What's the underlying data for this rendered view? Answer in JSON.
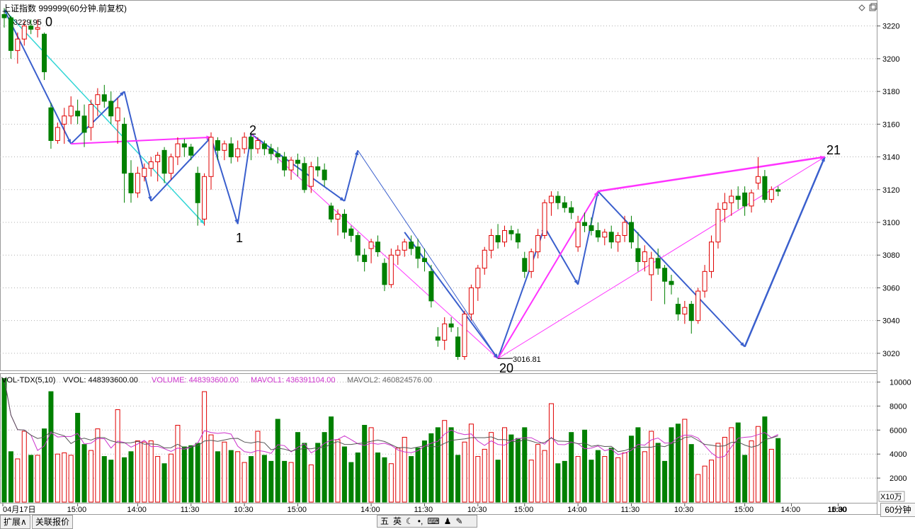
{
  "header": {
    "title": "上证指数 999999(60分钟.前复权)",
    "icons": [
      "diamond-icon",
      "restore-window-icon"
    ]
  },
  "price_axis": {
    "ticks": [
      "3220",
      "3200",
      "3180",
      "3160",
      "3140",
      "3120",
      "3100",
      "3080",
      "3060",
      "3040",
      "3020"
    ]
  },
  "volume_axis": {
    "ticks": [
      "10000",
      "8000",
      "6000",
      "4000",
      "2000"
    ],
    "unit": "X10万"
  },
  "volume_header": {
    "name": "VOL-TDX(5,10)",
    "vvol": "VVOL: 448393600.00",
    "volume": "VOLUME: 448393600.00",
    "mavol1": "MAVOL1: 436391104.00",
    "mavol2": "MAVOL2: 460824576.00"
  },
  "time_axis": [
    "04月17日",
    "15:00",
    "14:00",
    "11:30",
    "10:30",
    "15:00",
    "14:00",
    "11:30",
    "10:30",
    "15:00",
    "14:00",
    "11:30",
    "10:30",
    "15:00",
    "14:00",
    "11:30",
    "10:30",
    "15:00"
  ],
  "annotations": {
    "high_label": "3229.95",
    "low_label": "3016.81",
    "wave_labels": [
      "0",
      "1",
      "2",
      "20",
      "21"
    ]
  },
  "bottom_bar": {
    "tab_expand": "扩展∧",
    "tab_quote": "关联报价",
    "tray_items": [
      "五",
      "英",
      "☾",
      "•,",
      "⌨",
      "♟",
      "✎"
    ],
    "period": "60分钟"
  },
  "colors": {
    "up": "#e00000",
    "down": "#008000",
    "wave_blue": "#3a5fcd",
    "wave_magenta": "#ff33ff",
    "wave_cyan": "#33d6d6",
    "ma1": "#cc33cc",
    "ma2": "#555555",
    "grid": "#b0b0b0"
  },
  "chart_data": {
    "type": "candlestick",
    "price_range": [
      3010,
      3235
    ],
    "volume_range": [
      0,
      10500
    ],
    "candles": [
      [
        3227,
        3231,
        3219,
        3225
      ],
      [
        3225,
        3226,
        3200,
        3205
      ],
      [
        3205,
        3216,
        3197,
        3212
      ],
      [
        3212,
        3223,
        3208,
        3220
      ],
      [
        3220,
        3224,
        3215,
        3218
      ],
      [
        3218,
        3224,
        3213,
        3219
      ],
      [
        3215,
        3216,
        3187,
        3192
      ],
      [
        3170,
        3173,
        3145,
        3150
      ],
      [
        3150,
        3161,
        3148,
        3158
      ],
      [
        3160,
        3170,
        3148,
        3165
      ],
      [
        3165,
        3177,
        3160,
        3171
      ],
      [
        3168,
        3175,
        3160,
        3165
      ],
      [
        3165,
        3172,
        3146,
        3155
      ],
      [
        3158,
        3175,
        3150,
        3172
      ],
      [
        3172,
        3182,
        3165,
        3178
      ],
      [
        3178,
        3184,
        3170,
        3174
      ],
      [
        3174,
        3180,
        3160,
        3165
      ],
      [
        3162,
        3176,
        3148,
        3170
      ],
      [
        3160,
        3164,
        3112,
        3130
      ],
      [
        3130,
        3138,
        3112,
        3118
      ],
      [
        3118,
        3134,
        3115,
        3130
      ],
      [
        3128,
        3136,
        3125,
        3133
      ],
      [
        3133,
        3140,
        3128,
        3137
      ],
      [
        3137,
        3143,
        3125,
        3141
      ],
      [
        3144,
        3146,
        3124,
        3130
      ],
      [
        3130,
        3142,
        3126,
        3140
      ],
      [
        3140,
        3152,
        3135,
        3148
      ],
      [
        3148,
        3151,
        3140,
        3146
      ],
      [
        3146,
        3148,
        3138,
        3141
      ],
      [
        3130,
        3134,
        3098,
        3112
      ],
      [
        3102,
        3130,
        3098,
        3128
      ],
      [
        3128,
        3155,
        3120,
        3152
      ],
      [
        3150,
        3152,
        3138,
        3144
      ],
      [
        3144,
        3150,
        3138,
        3148
      ],
      [
        3148,
        3152,
        3136,
        3140
      ],
      [
        3140,
        3150,
        3137,
        3145
      ],
      [
        3145,
        3155,
        3142,
        3152
      ],
      [
        3152,
        3154,
        3138,
        3145
      ],
      [
        3145,
        3152,
        3142,
        3150
      ],
      [
        3148,
        3150,
        3141,
        3145
      ],
      [
        3145,
        3148,
        3138,
        3142
      ],
      [
        3142,
        3146,
        3136,
        3140
      ],
      [
        3140,
        3143,
        3128,
        3132
      ],
      [
        3132,
        3140,
        3126,
        3138
      ],
      [
        3138,
        3142,
        3128,
        3136
      ],
      [
        3136,
        3140,
        3118,
        3120
      ],
      [
        3122,
        3137,
        3118,
        3134
      ],
      [
        3134,
        3140,
        3128,
        3132
      ],
      [
        3132,
        3136,
        3122,
        3126
      ],
      [
        3110,
        3112,
        3100,
        3102
      ],
      [
        3102,
        3108,
        3092,
        3105
      ],
      [
        3105,
        3108,
        3090,
        3094
      ],
      [
        3096,
        3098,
        3088,
        3092
      ],
      [
        3092,
        3094,
        3076,
        3080
      ],
      [
        3080,
        3084,
        3070,
        3076
      ],
      [
        3084,
        3090,
        3075,
        3088
      ],
      [
        3088,
        3092,
        3079,
        3082
      ],
      [
        3075,
        3078,
        3058,
        3062
      ],
      [
        3062,
        3084,
        3060,
        3080
      ],
      [
        3080,
        3086,
        3074,
        3083
      ],
      [
        3083,
        3090,
        3079,
        3088
      ],
      [
        3088,
        3092,
        3080,
        3084
      ],
      [
        3085,
        3090,
        3072,
        3078
      ],
      [
        3078,
        3084,
        3070,
        3076
      ],
      [
        3070,
        3074,
        3048,
        3052
      ],
      [
        3030,
        3036,
        3024,
        3028
      ],
      [
        3028,
        3042,
        3022,
        3038
      ],
      [
        3038,
        3042,
        3033,
        3036
      ],
      [
        3030,
        3036,
        3016,
        3018
      ],
      [
        3018,
        3046,
        3016,
        3044
      ],
      [
        3044,
        3062,
        3040,
        3060
      ],
      [
        3060,
        3074,
        3052,
        3072
      ],
      [
        3072,
        3085,
        3068,
        3083
      ],
      [
        3083,
        3096,
        3078,
        3092
      ],
      [
        3092,
        3099,
        3084,
        3088
      ],
      [
        3088,
        3098,
        3085,
        3095
      ],
      [
        3095,
        3098,
        3089,
        3093
      ],
      [
        3093,
        3096,
        3084,
        3088
      ],
      [
        3078,
        3082,
        3066,
        3070
      ],
      [
        3070,
        3084,
        3066,
        3082
      ],
      [
        3082,
        3096,
        3078,
        3092
      ],
      [
        3092,
        3114,
        3090,
        3112
      ],
      [
        3112,
        3119,
        3104,
        3116
      ],
      [
        3116,
        3119,
        3108,
        3112
      ],
      [
        3112,
        3116,
        3106,
        3109
      ],
      [
        3109,
        3113,
        3102,
        3106
      ],
      [
        3085,
        3104,
        3082,
        3100
      ],
      [
        3100,
        3106,
        3094,
        3098
      ],
      [
        3098,
        3103,
        3092,
        3095
      ],
      [
        3095,
        3100,
        3088,
        3091
      ],
      [
        3091,
        3096,
        3086,
        3094
      ],
      [
        3094,
        3098,
        3084,
        3088
      ],
      [
        3088,
        3094,
        3082,
        3092
      ],
      [
        3092,
        3104,
        3088,
        3100
      ],
      [
        3100,
        3104,
        3084,
        3088
      ],
      [
        3084,
        3094,
        3070,
        3076
      ],
      [
        3076,
        3086,
        3070,
        3082
      ],
      [
        3068,
        3082,
        3052,
        3078
      ],
      [
        3078,
        3084,
        3068,
        3072
      ],
      [
        3072,
        3074,
        3050,
        3064
      ],
      [
        3064,
        3068,
        3056,
        3062
      ],
      [
        3050,
        3054,
        3040,
        3044
      ],
      [
        3044,
        3052,
        3038,
        3048
      ],
      [
        3050,
        3052,
        3032,
        3040
      ],
      [
        3040,
        3060,
        3038,
        3058
      ],
      [
        3058,
        3074,
        3054,
        3070
      ],
      [
        3070,
        3092,
        3066,
        3088
      ],
      [
        3088,
        3112,
        3084,
        3108
      ],
      [
        3108,
        3118,
        3100,
        3112
      ],
      [
        3112,
        3120,
        3104,
        3116
      ],
      [
        3116,
        3122,
        3108,
        3114
      ],
      [
        3118,
        3122,
        3104,
        3110
      ],
      [
        3110,
        3120,
        3106,
        3118
      ],
      [
        3124,
        3140,
        3120,
        3128
      ],
      [
        3128,
        3132,
        3112,
        3114
      ],
      [
        3114,
        3122,
        3112,
        3120
      ],
      [
        3120,
        3122,
        3116,
        3119
      ]
    ],
    "volumes": [
      10300,
      4200,
      3600,
      5900,
      3900,
      3900,
      6100,
      9200,
      4000,
      4100,
      3900,
      7400,
      4800,
      4300,
      6100,
      3800,
      3500,
      7700,
      3700,
      4200,
      5100,
      5000,
      5100,
      3800,
      3200,
      4000,
      6400,
      4600,
      4700,
      4900,
      9200,
      5600,
      4200,
      5000,
      4300,
      4200,
      3300,
      3800,
      5900,
      3900,
      3400,
      6900,
      3400,
      3300,
      5800,
      4900,
      3100,
      4900,
      5800,
      7100,
      5200,
      4600,
      3300,
      4100,
      6400,
      6200,
      4100,
      3700,
      3200,
      4500,
      5400,
      3800,
      4500,
      5100,
      5700,
      6200,
      6800,
      6200,
      3900,
      5000,
      6500,
      3800,
      4400,
      5800,
      3500,
      6200,
      5600,
      5300,
      6200,
      3500,
      4800,
      4300,
      8200,
      3200,
      3400,
      5800,
      3800,
      6000,
      3500,
      4300,
      3800,
      4500,
      3700,
      4100,
      5500,
      6200,
      4200,
      5900,
      4900,
      3400,
      6200,
      6500,
      6900,
      4800,
      2300,
      3000,
      3500,
      4900,
      5400,
      6200,
      6600,
      3900,
      5100,
      6300,
      7100,
      4400,
      5300,
      3900,
      7700,
      3100,
      3400,
      2600,
      4600
    ],
    "annotation_prices": {
      "high": 3229.95,
      "low": 3016.81
    }
  }
}
